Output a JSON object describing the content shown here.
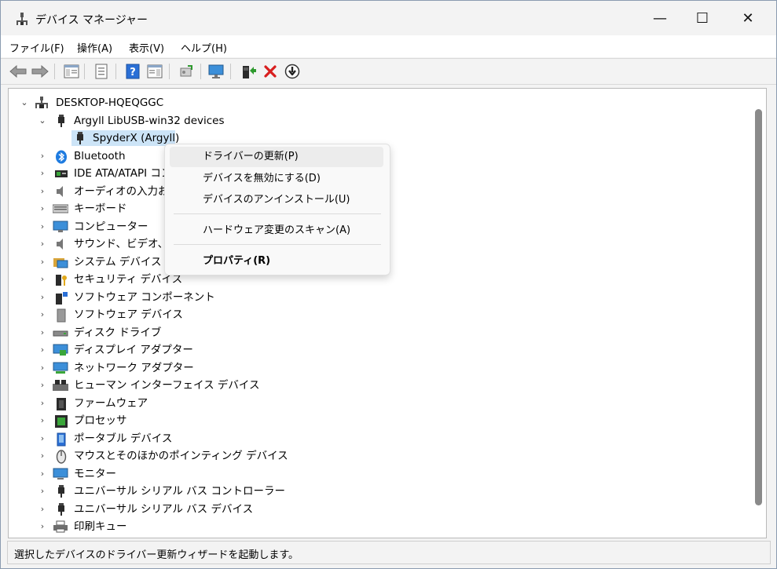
{
  "window": {
    "title": "デバイス マネージャー",
    "minimize": "—",
    "maximize": "☐",
    "close": "✕"
  },
  "menu": [
    "ファイル(F)",
    "操作(A)",
    "表示(V)",
    "ヘルプ(H)"
  ],
  "tree": {
    "root": "DESKTOP-HQEQGGC",
    "expanded_group": "Argyll LibUSB-win32 devices",
    "selected_device": "SpyderX (Argyll)",
    "categories": [
      "Bluetooth",
      "IDE ATA/ATAPI コン",
      "オーディオの入力およ",
      "キーボード",
      "コンピューター",
      "サウンド、ビデオ、およ",
      "システム デバイス",
      "セキュリティ デバイス",
      "ソフトウェア コンポーネント",
      "ソフトウェア デバイス",
      "ディスク ドライブ",
      "ディスプレイ アダプター",
      "ネットワーク アダプター",
      "ヒューマン インターフェイス デバイス",
      "ファームウェア",
      "プロセッサ",
      "ポータブル デバイス",
      "マウスとそのほかのポインティング デバイス",
      "モニター",
      "ユニバーサル シリアル バス コントローラー",
      "ユニバーサル シリアル バス デバイス",
      "印刷キュー"
    ]
  },
  "context_menu": {
    "update_driver": "ドライバーの更新(P)",
    "disable_device": "デバイスを無効にする(D)",
    "uninstall_device": "デバイスのアンインストール(U)",
    "scan_hardware": "ハードウェア変更のスキャン(A)",
    "properties": "プロパティ(R)"
  },
  "status_bar": "選択したデバイスのドライバー更新ウィザードを起動します。",
  "colors": {
    "selection": "#cce4f7",
    "remove_red": "#d81e1e",
    "help_blue": "#2a6fd6",
    "scrollbar": "#8a8a8a"
  }
}
